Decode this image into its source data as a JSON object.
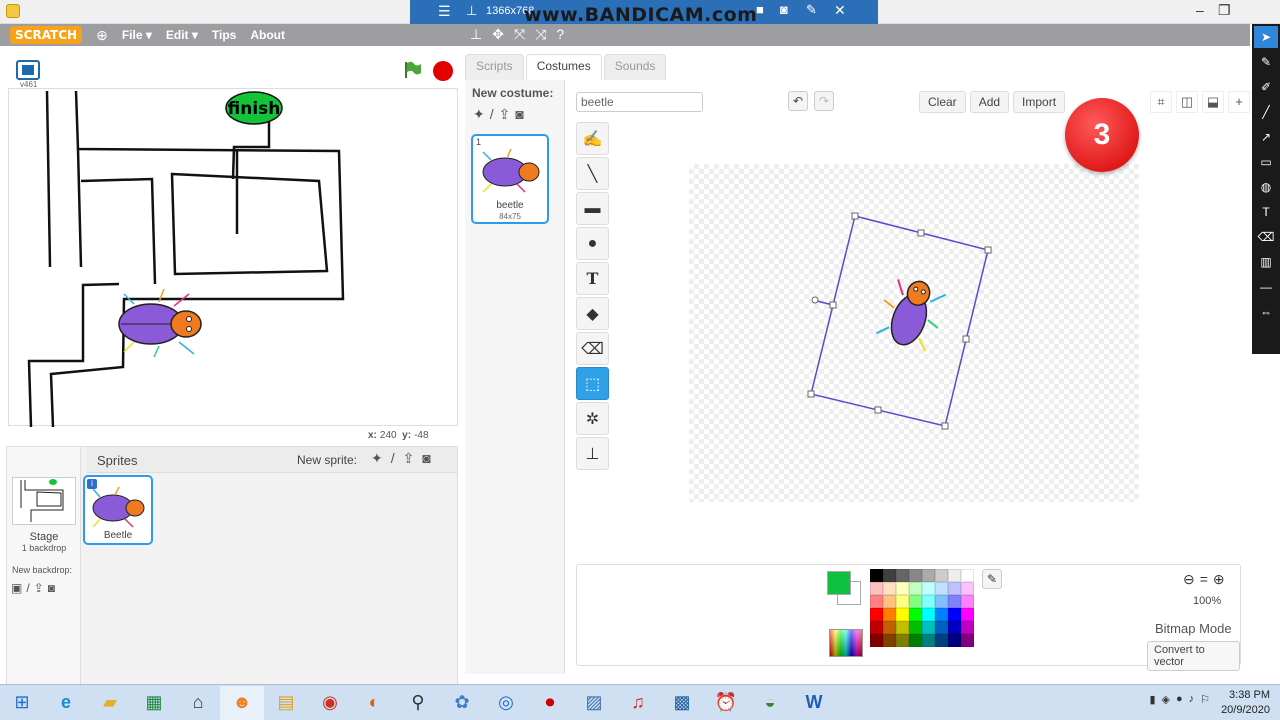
{
  "recorder": {
    "resolution": "1366x768",
    "watermark": "www.BANDICAM.com"
  },
  "menu": {
    "logo": "SCRATCH",
    "items": [
      "File ▾",
      "Edit ▾",
      "Tips",
      "About"
    ]
  },
  "stage": {
    "version": "v461",
    "finish_label": "finish",
    "x_label": "x:",
    "x_value": "240",
    "y_label": "y:",
    "y_value": "-48"
  },
  "sprites": {
    "title": "Sprites",
    "new_sprite": "New sprite:",
    "stage_label": "Stage",
    "stage_sub": "1 backdrop",
    "new_backdrop": "New backdrop:",
    "sprite_name": "Beetle",
    "sprite_info": "i"
  },
  "tabs": [
    "Scripts",
    "Costumes",
    "Sounds"
  ],
  "costumes": {
    "new_costume": "New costume:",
    "items": [
      {
        "num": "1",
        "name": "beetle",
        "size": "84x75"
      }
    ]
  },
  "editor": {
    "name_value": "beetle",
    "buttons": [
      "Clear",
      "Add",
      "Import"
    ],
    "badge": "3",
    "zoom": "100%",
    "mode": "Bitmap Mode",
    "convert": "Convert to vector",
    "current_color": "#10c040"
  },
  "palette": [
    "#000000",
    "#404040",
    "#666666",
    "#888888",
    "#aaaaaa",
    "#cccccc",
    "#eeeeee",
    "#ffffff",
    "#ffc0c0",
    "#ffe0c0",
    "#ffffc0",
    "#c0ffc0",
    "#c0ffff",
    "#c0e0ff",
    "#c0c0ff",
    "#ffc0ff",
    "#ff8080",
    "#ffc080",
    "#ffff80",
    "#80ff80",
    "#80ffff",
    "#80c0ff",
    "#8080ff",
    "#ff80ff",
    "#ff0000",
    "#ff8000",
    "#ffff00",
    "#00ff00",
    "#00ffff",
    "#0080ff",
    "#0000ff",
    "#ff00ff",
    "#c00000",
    "#c06000",
    "#c0c000",
    "#00c000",
    "#00c0c0",
    "#0060c0",
    "#0000c0",
    "#c000c0",
    "#800000",
    "#804000",
    "#808000",
    "#008000",
    "#008080",
    "#004080",
    "#000080",
    "#800080"
  ],
  "taskbar": {
    "time": "3:38 PM",
    "date": "20/9/2020"
  }
}
